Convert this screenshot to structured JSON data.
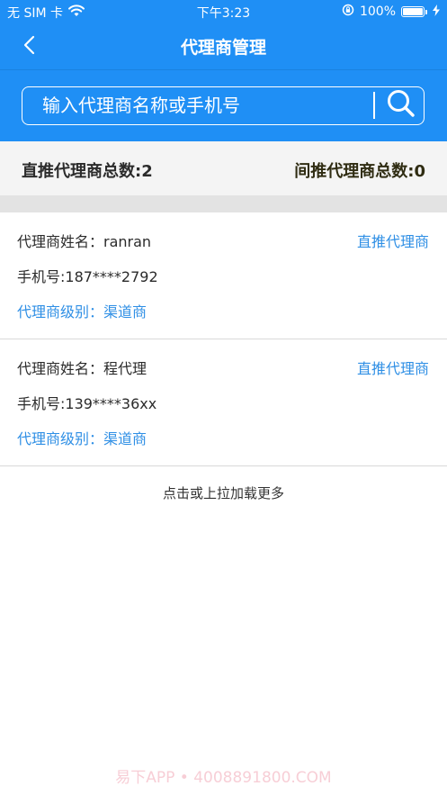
{
  "status_bar": {
    "carrier": "无 SIM 卡",
    "time": "下午3:23",
    "battery_percent": "100%",
    "battery_level": 1.0,
    "icons": [
      "wifi-icon",
      "orientation-lock-icon",
      "battery-icon",
      "charging-bolt-icon"
    ]
  },
  "nav": {
    "title": "代理商管理",
    "back_icon": "chevron-left-icon"
  },
  "search": {
    "placeholder": "输入代理商名称或手机号",
    "value": "",
    "icon": "search-icon"
  },
  "summary": {
    "direct_label": "直推代理商总数:2",
    "indirect_label": "间推代理商总数:0"
  },
  "agents": [
    {
      "name_line": "代理商姓名：ranran",
      "phone_line": "手机号:187****2792",
      "level_line": "代理商级别：渠道商",
      "type": "直推代理商"
    },
    {
      "name_line": "代理商姓名：程代理",
      "phone_line": "手机号:139****36xx",
      "level_line": "代理商级别：渠道商",
      "type": "直推代理商"
    }
  ],
  "load_more": "点击或上拉加载更多",
  "watermark": "易下APP • 4008891800.COM",
  "colors": {
    "brand_blue": "#1f8ff5",
    "link_blue": "#2f8fe5",
    "summary_bg": "#f4f4f4",
    "gap_bg": "#e3e3e3"
  }
}
